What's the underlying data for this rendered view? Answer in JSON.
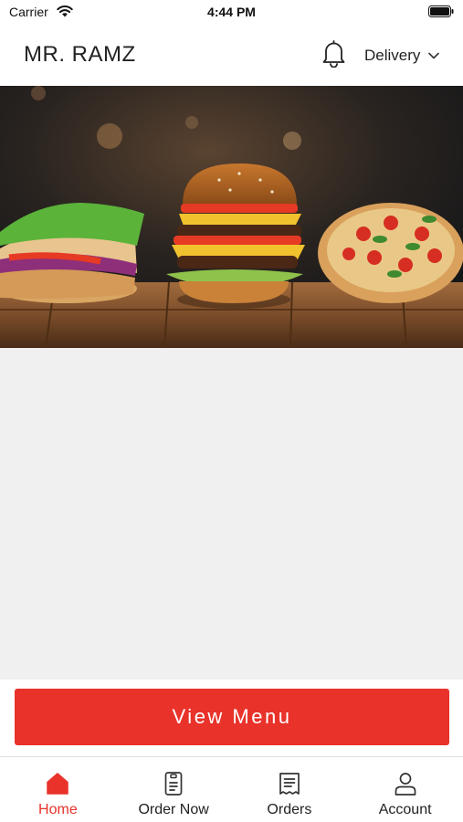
{
  "status_bar": {
    "carrier": "Carrier",
    "time": "4:44 PM"
  },
  "header": {
    "brand": "MR. RAMZ",
    "delivery_mode": "Delivery",
    "icons": [
      "bell-icon",
      "chevron-down-icon"
    ]
  },
  "hero": {
    "image": "burger, pizza and wrap on wooden table"
  },
  "cta": {
    "view_menu_label": "View Menu"
  },
  "tabs": [
    {
      "label": "Home",
      "icon": "home-icon",
      "active": true
    },
    {
      "label": "Order Now",
      "icon": "order-icon",
      "active": false
    },
    {
      "label": "Orders",
      "icon": "receipt-icon",
      "active": false
    },
    {
      "label": "Account",
      "icon": "user-icon",
      "active": false
    }
  ],
  "colors": {
    "accent": "#e8322a",
    "background": "#f0f0f0",
    "text": "#222222"
  }
}
